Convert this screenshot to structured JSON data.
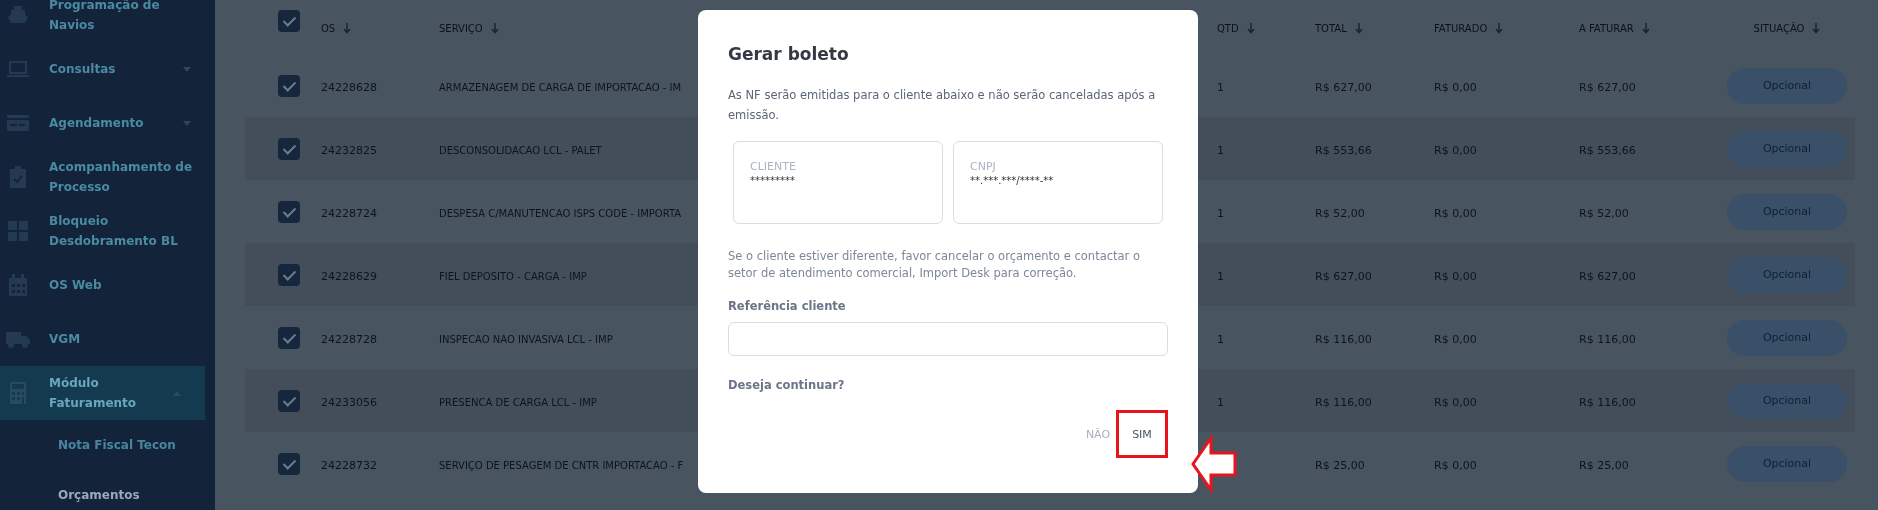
{
  "sidebar": {
    "items": [
      {
        "label": "Programação de Navios",
        "selected": false
      },
      {
        "label": "Consultas",
        "selected": false,
        "expanded": false
      },
      {
        "label": "Agendamento",
        "selected": false,
        "expanded": false
      },
      {
        "label": "Acompanhamento de Processo",
        "selected": false
      },
      {
        "label": "Bloqueio Desdobramento BL",
        "selected": false
      },
      {
        "label": "OS Web",
        "selected": false
      },
      {
        "label": "VGM",
        "selected": false
      },
      {
        "label": "Módulo Faturamento",
        "selected": true,
        "expanded": true,
        "children": [
          {
            "label": "Nota Fiscal Tecon",
            "selected": false
          },
          {
            "label": "Orçamentos",
            "selected": true
          }
        ]
      }
    ]
  },
  "table": {
    "header_checked": true,
    "columns": [
      "OS",
      "SERVIÇO",
      "QTD",
      "TOTAL",
      "FATURADO",
      "A FATURAR",
      "SITUAÇÃO"
    ],
    "rows": [
      {
        "checked": true,
        "os": "24228628",
        "service": "ARMAZENAGEM DE CARGA DE IMPORTACAO - IM",
        "qtd": "1",
        "total": "R$ 627,00",
        "faturado": "R$ 0,00",
        "a_faturar": "R$ 627,00",
        "status": "Opcional"
      },
      {
        "checked": true,
        "os": "24232825",
        "service": "DESCONSOLIDACAO LCL - PALET",
        "qtd": "1",
        "total": "R$ 553,66",
        "faturado": "R$ 0,00",
        "a_faturar": "R$ 553,66",
        "status": "Opcional"
      },
      {
        "checked": true,
        "os": "24228724",
        "service": "DESPESA C/MANUTENCAO ISPS CODE - IMPORTA",
        "qtd": "1",
        "total": "R$ 52,00",
        "faturado": "R$ 0,00",
        "a_faturar": "R$ 52,00",
        "status": "Opcional"
      },
      {
        "checked": true,
        "os": "24228629",
        "service": "FIEL DEPOSITO - CARGA - IMP",
        "qtd": "1",
        "total": "R$ 627,00",
        "faturado": "R$ 0,00",
        "a_faturar": "R$ 627,00",
        "status": "Opcional"
      },
      {
        "checked": true,
        "os": "24228728",
        "service": "INSPECAO NAO INVASIVA LCL - IMP",
        "qtd": "1",
        "total": "R$ 116,00",
        "faturado": "R$ 0,00",
        "a_faturar": "R$ 116,00",
        "status": "Opcional"
      },
      {
        "checked": true,
        "os": "24233056",
        "service": "PRESENCA DE CARGA LCL - IMP",
        "qtd": "1",
        "total": "R$ 116,00",
        "faturado": "R$ 0,00",
        "a_faturar": "R$ 116,00",
        "status": "Opcional"
      },
      {
        "checked": true,
        "os": "24228732",
        "service": "SERVIÇO DE PESAGEM DE CNTR IMPORTACAO - F",
        "total": "R$ 25,00",
        "faturado": "R$ 0,00",
        "a_faturar": "R$ 25,00",
        "status": "Opcional"
      }
    ]
  },
  "dialog": {
    "title": "Gerar boleto",
    "message": "As NF serão emitidas para o cliente abaixo e não serão canceladas após a emissão.",
    "fields": [
      {
        "label": "CLIENTE",
        "value": "*********"
      },
      {
        "label": "CNPJ",
        "value": "**.***.***/****-**"
      }
    ],
    "note": "Se o cliente estiver diferente, favor cancelar o orçamento e contactar o setor de atendimento comercial, Import Desk para correção.",
    "reference_label": "Referência cliente",
    "question": "Deseja continuar?",
    "buttons": [
      {
        "label": "NÃO",
        "kind": "secondary",
        "highlighted": false
      },
      {
        "label": "SIM",
        "kind": "primary",
        "highlighted": true
      }
    ]
  }
}
